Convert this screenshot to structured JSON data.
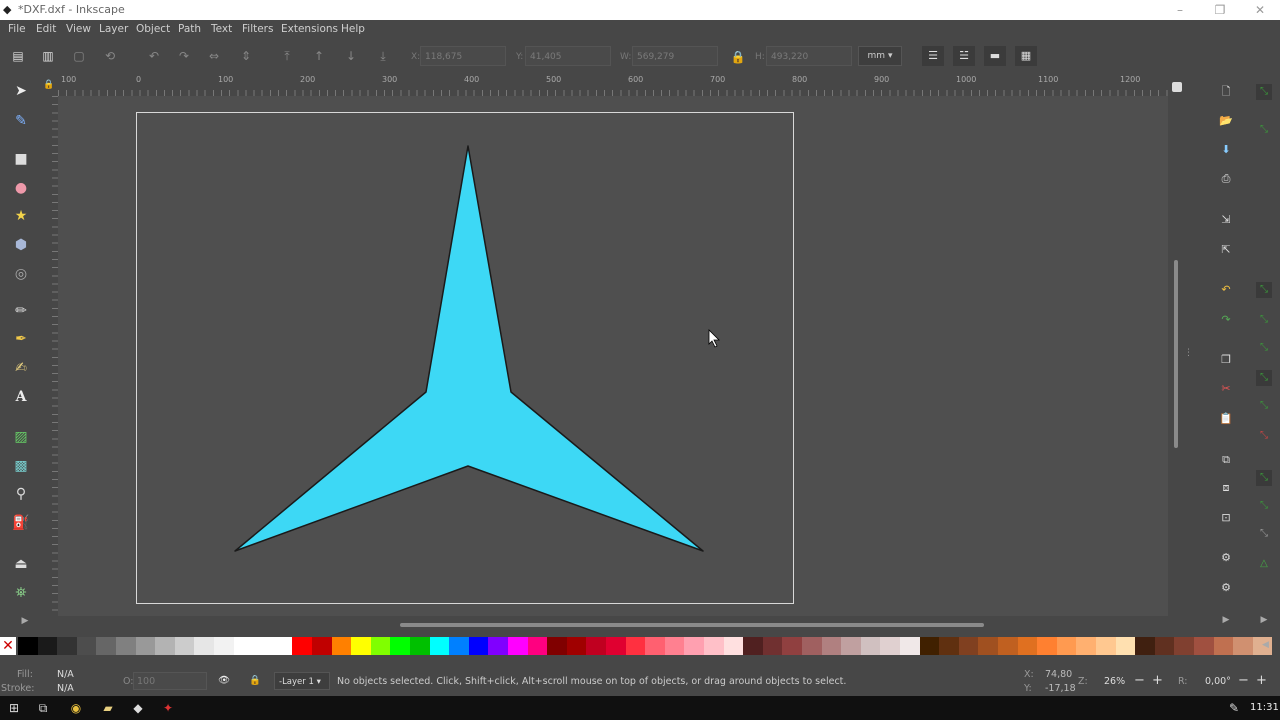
{
  "window": {
    "title": "*DXF.dxf - Inkscape",
    "minimize": "–",
    "maximize": "❐",
    "close": "✕"
  },
  "menu": [
    "File",
    "Edit",
    "View",
    "Layer",
    "Object",
    "Path",
    "Text",
    "Filters",
    "Extensions",
    "Help"
  ],
  "controls": {
    "x_label": "X:",
    "x_value": "118,675",
    "y_label": "Y:",
    "y_value": "41,405",
    "w_label": "W:",
    "w_value": "569,279",
    "h_label": "H:",
    "h_value": "493,220",
    "unit": "mm",
    "unit_arrow": "▾"
  },
  "ruler_labels": [
    "100",
    "0",
    "100",
    "200",
    "300",
    "400",
    "500",
    "600",
    "700",
    "800",
    "900",
    "1000",
    "1100",
    "1200"
  ],
  "shape": {
    "fill": "#3dd8f5",
    "stroke": "#1a1a1a"
  },
  "palette_colors": [
    "#000000",
    "#1a1a1a",
    "#333333",
    "#4d4d4d",
    "#666666",
    "#808080",
    "#999999",
    "#b3b3b3",
    "#cccccc",
    "#e6e6e6",
    "#f2f2f2",
    "#ffffff",
    "#ffffff",
    "#ffffff",
    "#ff0000",
    "#c00000",
    "#ff8000",
    "#ffff00",
    "#80ff00",
    "#00ff00",
    "#00c000",
    "#00ffff",
    "#0080ff",
    "#0000ff",
    "#8000ff",
    "#ff00ff",
    "#ff0080",
    "#800000",
    "#a00000",
    "#c00020",
    "#e00030",
    "#ff3040",
    "#ff6070",
    "#ff8090",
    "#ffa0b0",
    "#ffc0c8",
    "#ffe0e0",
    "#502020",
    "#703030",
    "#904040",
    "#a06060",
    "#b08080",
    "#c0a0a0",
    "#d0c0c0",
    "#e0d0d0",
    "#f0e8e8",
    "#402000",
    "#603010",
    "#804020",
    "#a05020",
    "#c06020",
    "#e07020",
    "#ff8030",
    "#ff9a50",
    "#ffb070",
    "#ffc890",
    "#ffe0b0",
    "#402010",
    "#603020",
    "#804030",
    "#a05040",
    "#c07050",
    "#d09070",
    "#e0b090"
  ],
  "status": {
    "fill_label": "Fill:",
    "fill_value": "N/A",
    "stroke_label": "Stroke:",
    "stroke_value": "N/A",
    "opacity_label": "O:",
    "opacity_value": "100",
    "layer": "-Layer 1",
    "layer_arrow": "▾",
    "message": "No objects selected. Click, Shift+click, Alt+scroll mouse on top of objects, or drag around objects to select.",
    "x_label": "X:",
    "x_value": "74,80",
    "y_label": "Y:",
    "y_value": "-17,18",
    "zoom_label": "Z:",
    "zoom_value": "26%",
    "zoom_minus": "−",
    "zoom_plus": "+",
    "rotation_label": "R:",
    "rotation_value": "0,00°",
    "rotation_minus": "−",
    "rotation_plus": "+"
  },
  "clock": "11:31",
  "icons": [
    "inkscape-logo-icon",
    "selector-icon",
    "node-icon",
    "rect-icon",
    "circle-icon",
    "star-icon",
    "3dbox-icon",
    "spiral-icon",
    "pencil-icon",
    "pen-icon",
    "calligraphy-icon",
    "text-icon",
    "gradient-icon",
    "mesh-icon",
    "dropper-icon",
    "paint-bucket-icon",
    "tweak-icon",
    "spray-icon"
  ]
}
